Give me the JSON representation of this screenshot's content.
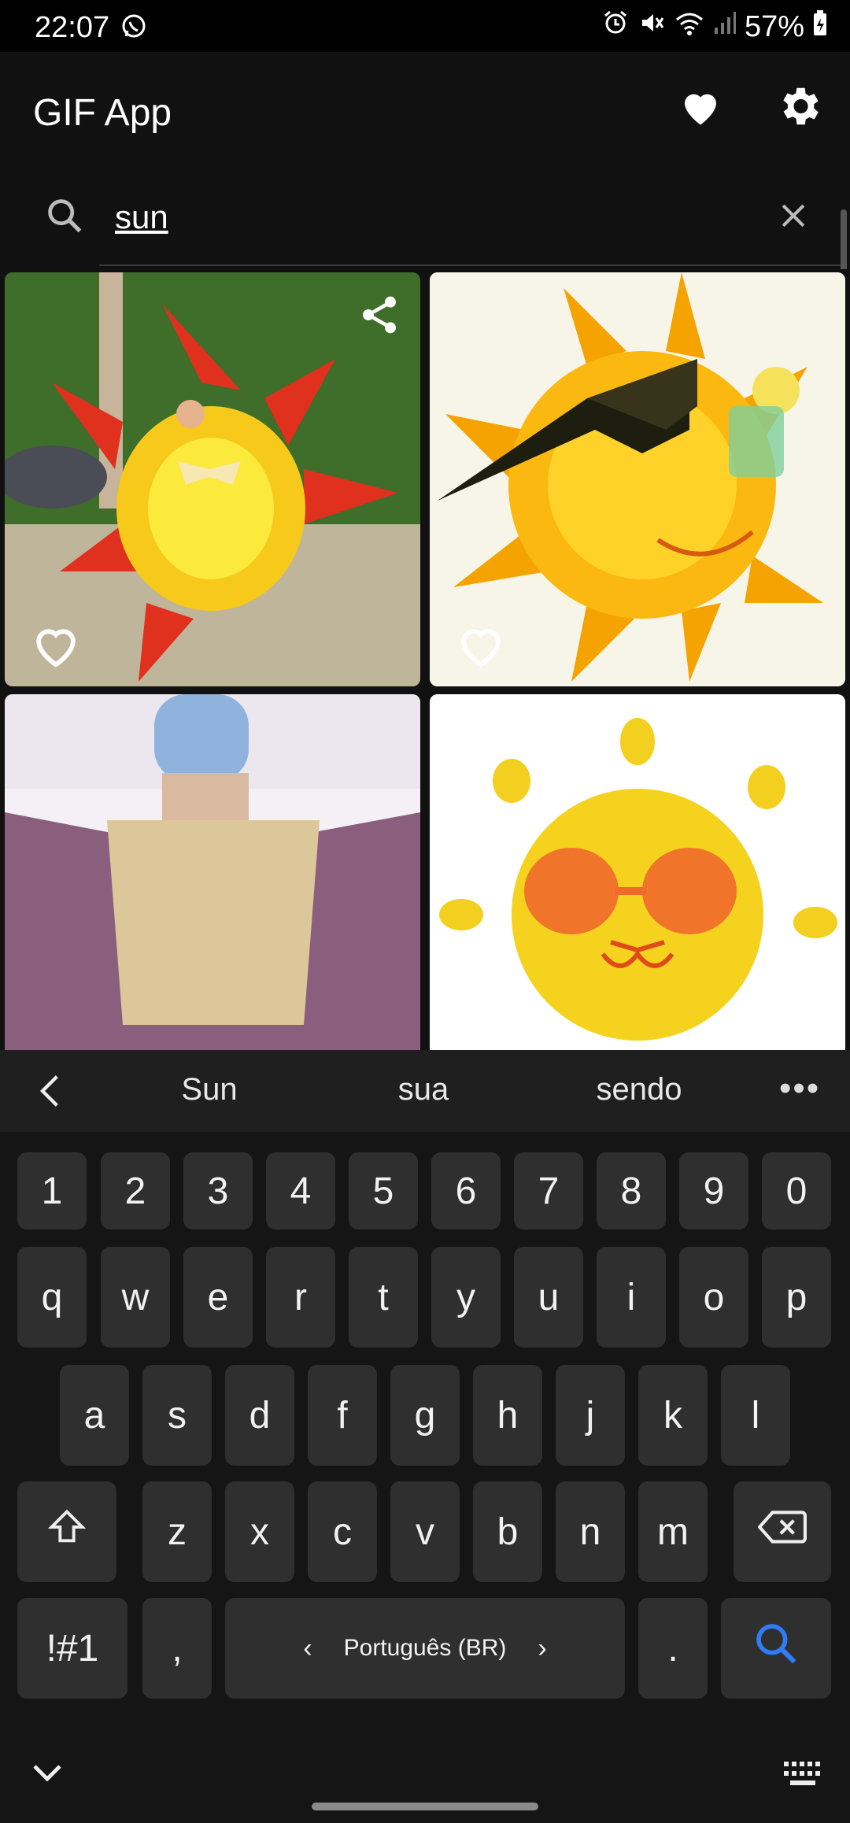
{
  "status_bar": {
    "time": "22:07",
    "battery": "57%"
  },
  "app_bar": {
    "title": "GIF App"
  },
  "search": {
    "query": "sun"
  },
  "gifs": [
    {
      "id": "gif-1"
    },
    {
      "id": "gif-2"
    },
    {
      "id": "gif-3"
    },
    {
      "id": "gif-4"
    }
  ],
  "keyboard": {
    "suggestions": [
      "Sun",
      "sua",
      "sendo"
    ],
    "more": "•••",
    "row_numbers": [
      "1",
      "2",
      "3",
      "4",
      "5",
      "6",
      "7",
      "8",
      "9",
      "0"
    ],
    "row_q": [
      "q",
      "w",
      "e",
      "r",
      "t",
      "y",
      "u",
      "i",
      "o",
      "p"
    ],
    "row_a": [
      "a",
      "s",
      "d",
      "f",
      "g",
      "h",
      "j",
      "k",
      "l"
    ],
    "row_z": [
      "z",
      "x",
      "c",
      "v",
      "b",
      "n",
      "m"
    ],
    "symbols_label": "!#1",
    "comma": ",",
    "period": ".",
    "space_label": "Português (BR)",
    "space_left": "‹",
    "space_right": "›"
  },
  "colors": {
    "accent": "#2f7cf6",
    "key_bg": "#2f2f2f",
    "app_bg": "#111111"
  }
}
